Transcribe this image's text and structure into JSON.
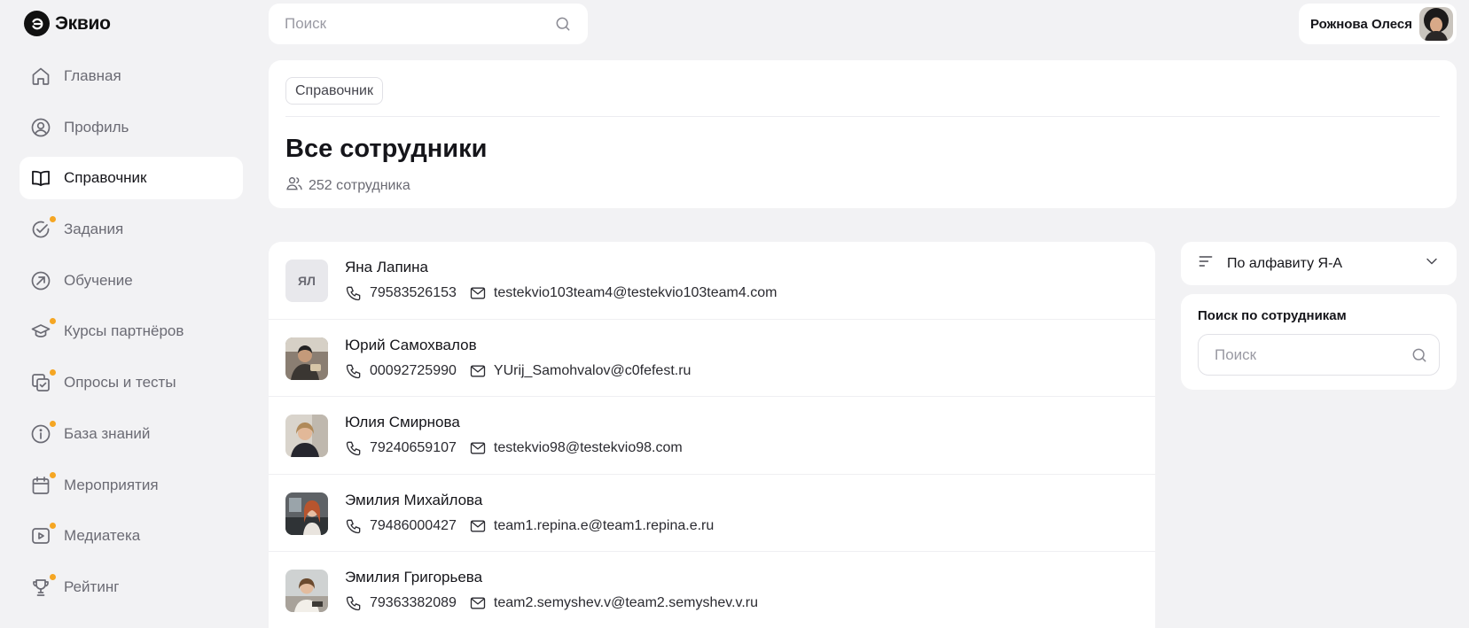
{
  "app": {
    "name": "Эквио"
  },
  "search": {
    "placeholder": "Поиск"
  },
  "user": {
    "name": "Рожнова Олеся"
  },
  "sidebar": {
    "items": [
      {
        "label": "Главная",
        "icon": "home-icon",
        "active": false,
        "dot": false
      },
      {
        "label": "Профиль",
        "icon": "profile-icon",
        "active": false,
        "dot": false
      },
      {
        "label": "Справочник",
        "icon": "book-icon",
        "active": true,
        "dot": false
      },
      {
        "label": "Задания",
        "icon": "check-circle-icon",
        "active": false,
        "dot": true
      },
      {
        "label": "Обучение",
        "icon": "learning-arrow-icon",
        "active": false,
        "dot": false
      },
      {
        "label": "Курсы партнёров",
        "icon": "graduation-cap-icon",
        "active": false,
        "dot": true
      },
      {
        "label": "Опросы и тесты",
        "icon": "survey-icon",
        "active": false,
        "dot": true
      },
      {
        "label": "База знаний",
        "icon": "info-icon",
        "active": false,
        "dot": true
      },
      {
        "label": "Мероприятия",
        "icon": "calendar-icon",
        "active": false,
        "dot": true
      },
      {
        "label": "Медиатека",
        "icon": "media-play-icon",
        "active": false,
        "dot": true
      },
      {
        "label": "Рейтинг",
        "icon": "trophy-icon",
        "active": false,
        "dot": true
      }
    ]
  },
  "header": {
    "breadcrumb": "Справочник",
    "title": "Все сотрудники",
    "count": "252 сотрудника"
  },
  "employees": [
    {
      "name": "Яна Лапина",
      "initials": "ЯЛ",
      "phone": "79583526153",
      "email": "testekvio103team4@testekvio103team4.com",
      "photo": false
    },
    {
      "name": "Юрий Самохвалов",
      "initials": "",
      "phone": "00092725990",
      "email": "YUrij_Samohvalov@c0fefest.ru",
      "photo": true
    },
    {
      "name": "Юлия Смирнова",
      "initials": "",
      "phone": "79240659107",
      "email": "testekvio98@testekvio98.com",
      "photo": true
    },
    {
      "name": "Эмилия Михайлова",
      "initials": "",
      "phone": "79486000427",
      "email": "team1.repina.e@team1.repina.e.ru",
      "photo": true
    },
    {
      "name": "Эмилия Григорьева",
      "initials": "",
      "phone": "79363382089",
      "email": "team2.semyshev.v@team2.semyshev.v.ru",
      "photo": true
    }
  ],
  "sort": {
    "label": "По алфавиту Я-А"
  },
  "filter": {
    "title": "Поиск по сотрудникам",
    "placeholder": "Поиск"
  },
  "colors": {
    "accent_dot": "#f5a623",
    "background": "#f2f2f4",
    "card": "#ffffff",
    "text": "#15151a",
    "muted": "#6b6b74"
  }
}
